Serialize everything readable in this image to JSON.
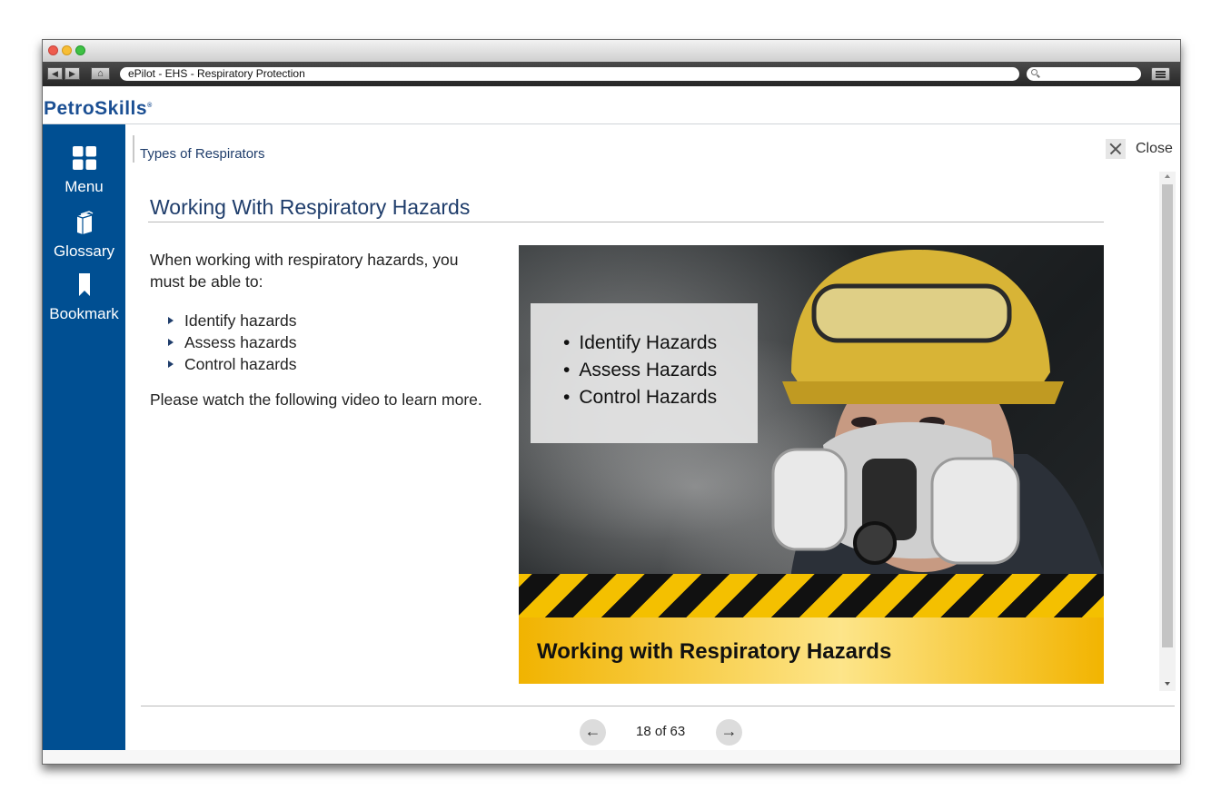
{
  "browser": {
    "url_text": "ePilot - EHS - Respiratory Protection",
    "nav_buttons": {
      "back": "◀",
      "forward": "▶",
      "home": "⌂"
    }
  },
  "header": {
    "logo_text": "PetroSkills",
    "logo_mark": "®",
    "brand_color": "#1b4f93"
  },
  "sidebar": {
    "color": "#004f92",
    "items": [
      {
        "label": "Menu",
        "icon": "grid-icon"
      },
      {
        "label": "Glossary",
        "icon": "book-icon"
      },
      {
        "label": "Bookmark",
        "icon": "bookmark-icon"
      }
    ]
  },
  "content": {
    "breadcrumb": "Types of Respirators",
    "close_label": "Close",
    "title": "Working With Respiratory Hazards",
    "intro": "When working with respiratory hazards, you must be able to:",
    "bullets": [
      "Identify hazards",
      "Assess hazards",
      "Control hazards"
    ],
    "outro": "Please watch the following video to learn more."
  },
  "video": {
    "overlay_items": [
      "Identify Hazards",
      "Assess Hazards",
      "Control Hazards"
    ],
    "banner_title": "Working with Respiratory Hazards"
  },
  "pager": {
    "prev": "←",
    "status": "18 of 63",
    "next": "→"
  }
}
